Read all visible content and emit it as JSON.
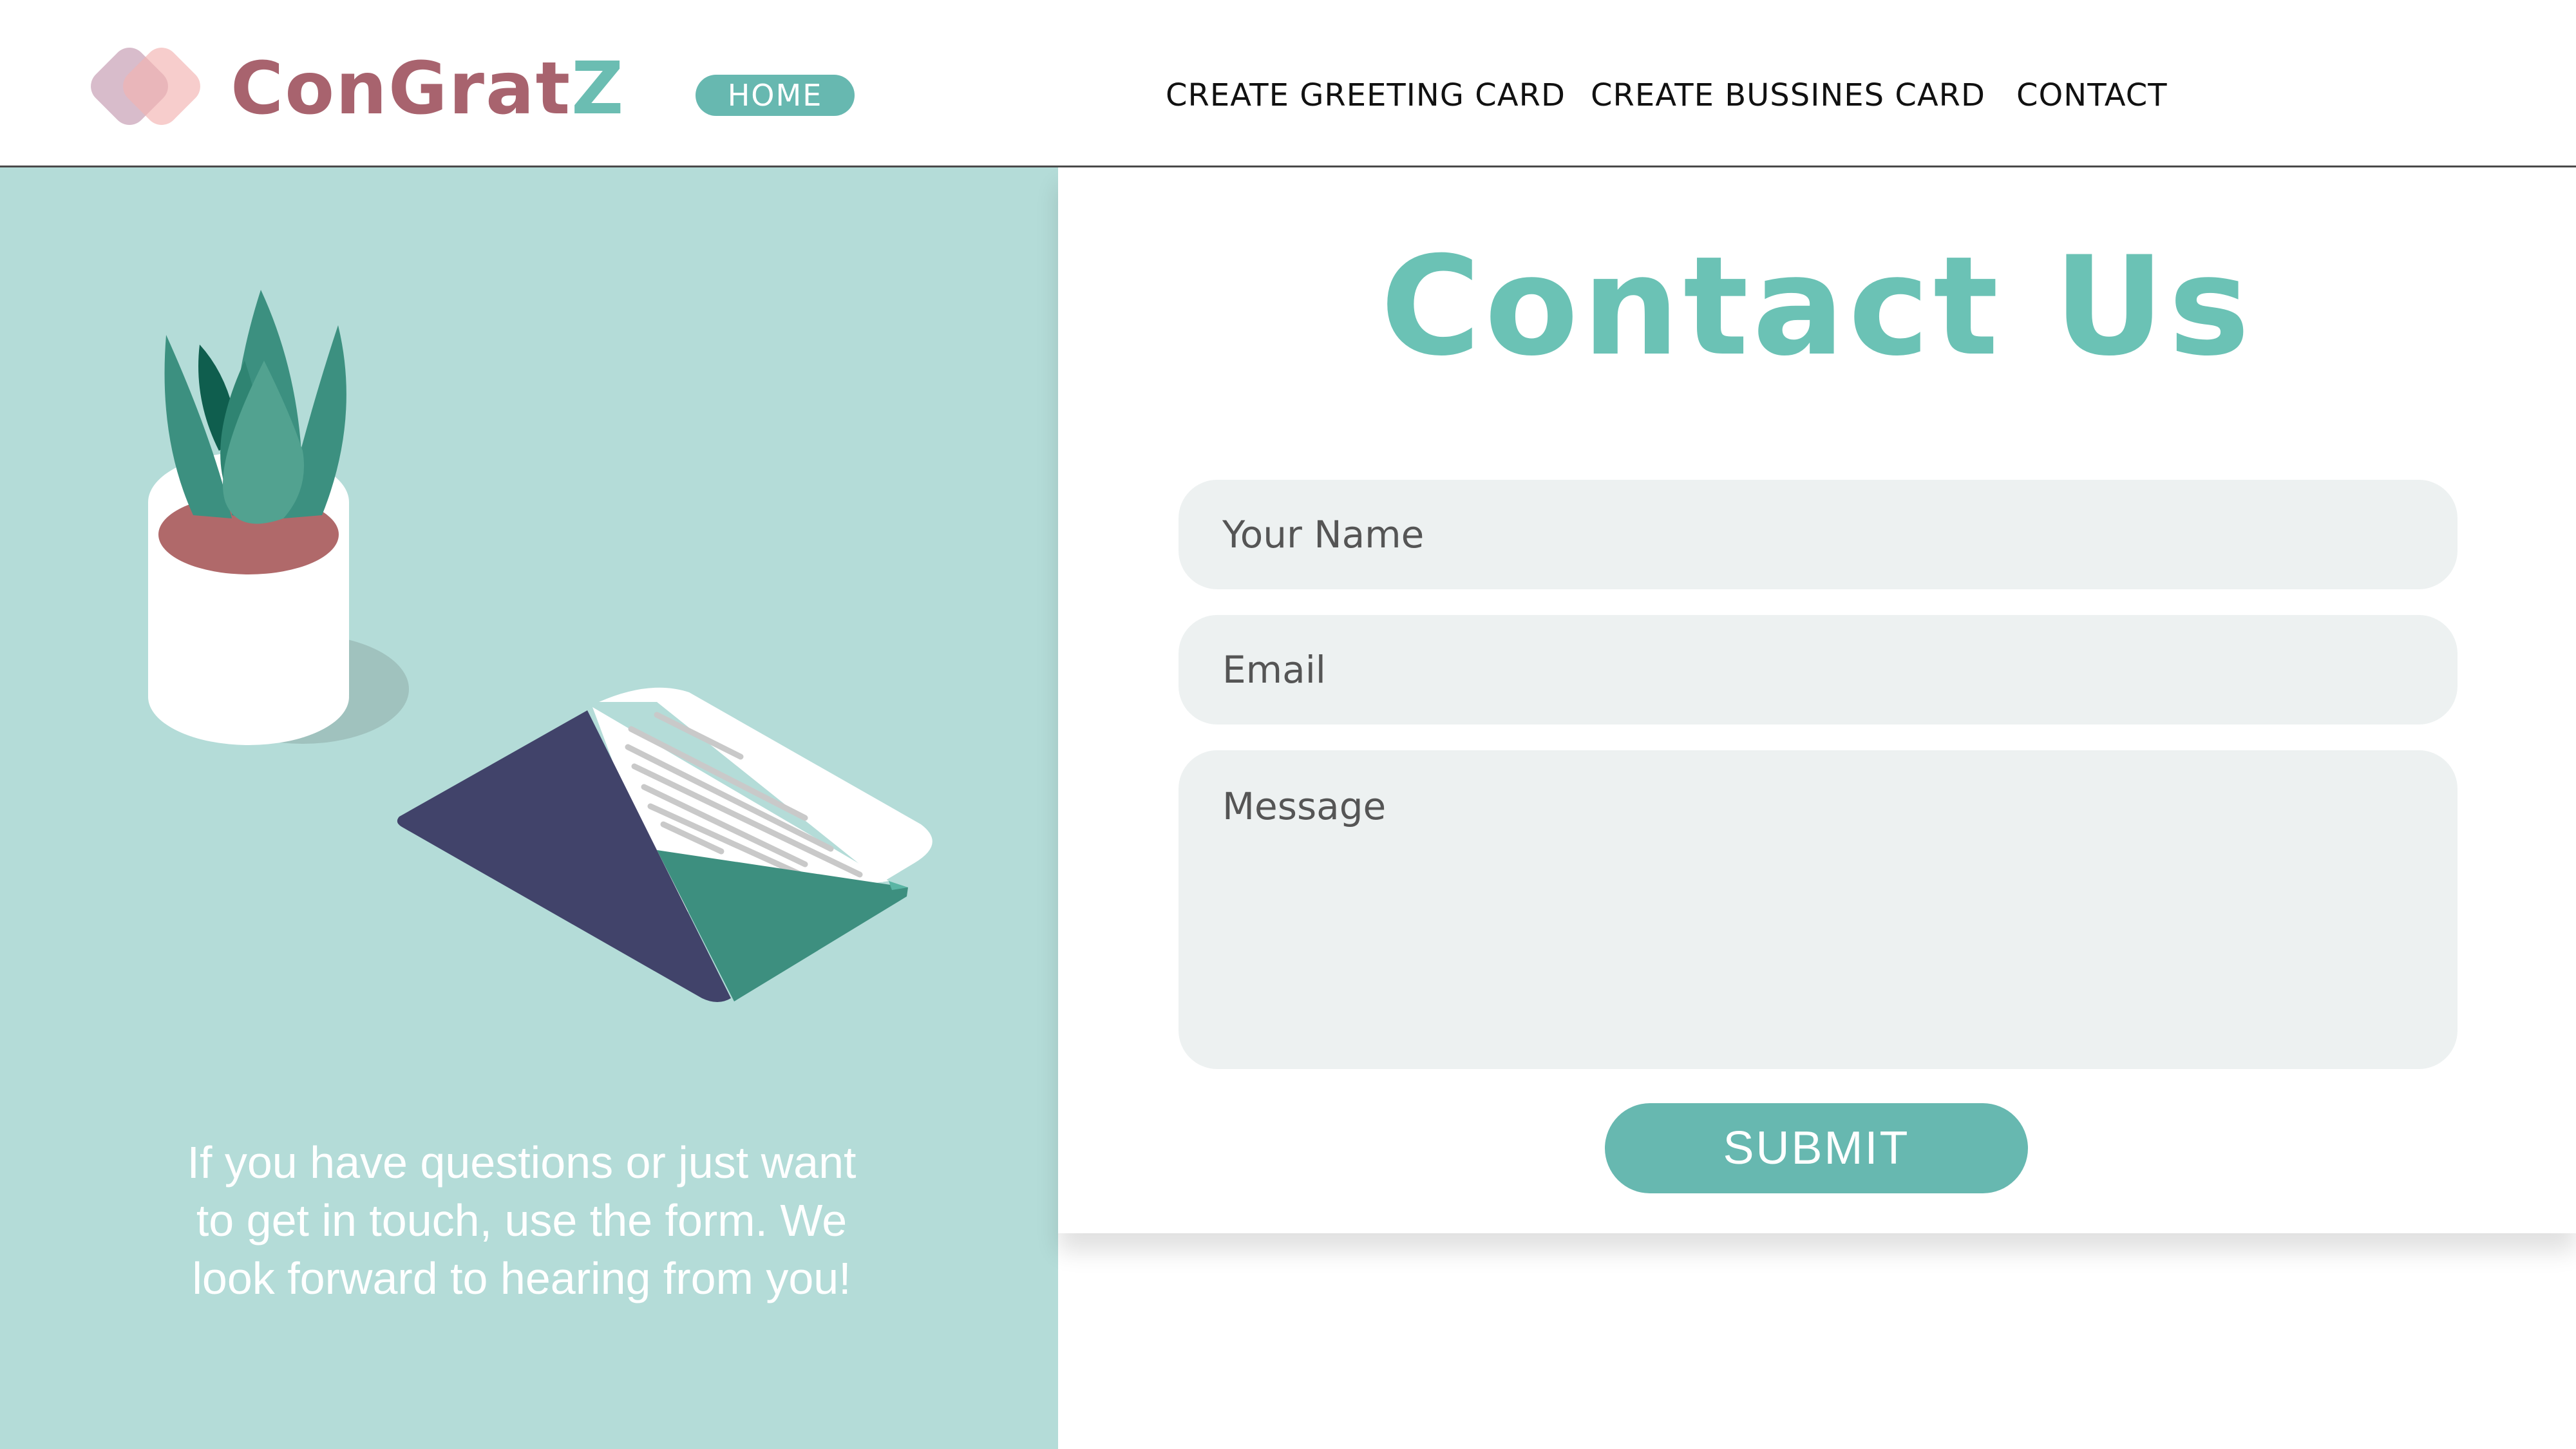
{
  "colors": {
    "brand_pink": "#a8636e",
    "brand_teal": "#6bbdb2",
    "accent": "#67b8b0",
    "panel_bg": "#b4dcd8",
    "field_bg": "#edf1f1",
    "title": "#6bc2b5"
  },
  "header": {
    "brand_part1": "ConGrat",
    "brand_part2": "Z",
    "logo_icon": "overlapping-rounded-squares-icon",
    "nav": {
      "home": "HOME",
      "greeting": "CREATE GREETING CARD",
      "business": "CREATE BUSSINES CARD",
      "contact": "CONTACT"
    }
  },
  "left_panel": {
    "illustration": [
      "potted-plant-icon",
      "open-envelope-letter-icon"
    ],
    "blurb": "If you have questions or just want to get in touch, use the form. We look forward to hearing from you!"
  },
  "form": {
    "title": "Contact Us",
    "name_placeholder": "Your Name",
    "email_placeholder": "Email",
    "message_placeholder": "Message",
    "submit_label": "SUBMIT"
  }
}
